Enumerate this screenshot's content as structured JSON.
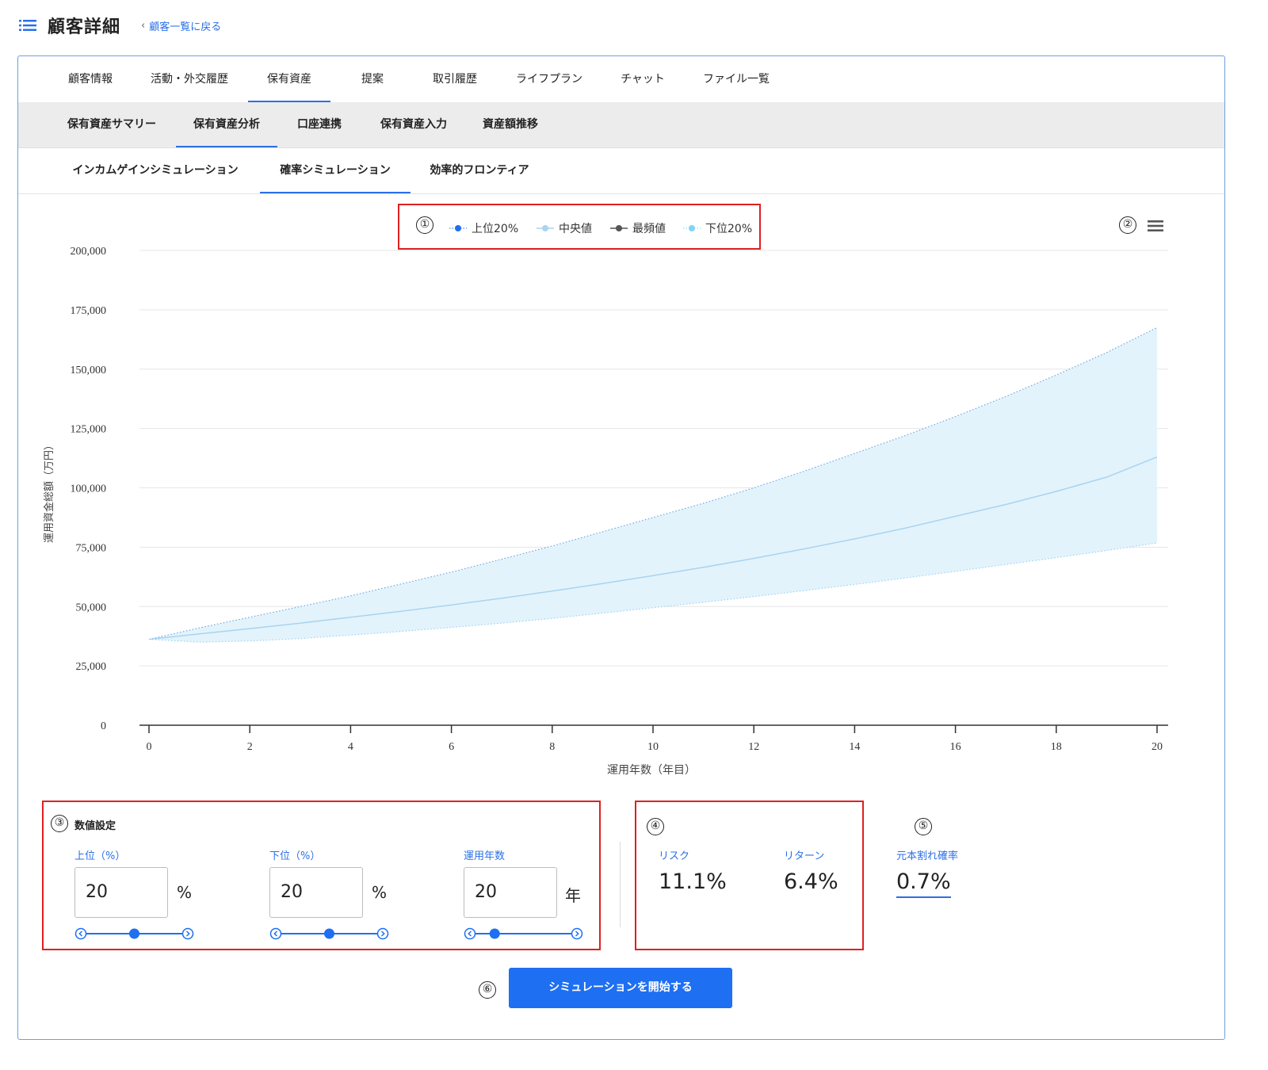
{
  "header": {
    "title": "顧客詳細",
    "back_link": "顧客一覧に戻る"
  },
  "tabs_primary": [
    "顧客情報",
    "活動・外交履歴",
    "保有資産",
    "提案",
    "取引履歴",
    "ライフプラン",
    "チャット",
    "ファイル一覧"
  ],
  "tabs_primary_active": "保有資産",
  "tabs_secondary": [
    "保有資産サマリー",
    "保有資産分析",
    "口座連携",
    "保有資産入力",
    "資産額推移"
  ],
  "tabs_secondary_active": "保有資産分析",
  "tabs_tertiary": [
    "インカムゲインシミュレーション",
    "確率シミュレーション",
    "効率的フロンティア"
  ],
  "tabs_tertiary_active": "確率シミュレーション",
  "annotations": [
    "①",
    "②",
    "③",
    "④",
    "⑤",
    "⑥"
  ],
  "chart_data": {
    "type": "area",
    "xlabel": "運用年数（年目）",
    "ylabel": "運用資金総額（万円）",
    "xlim": [
      0,
      20
    ],
    "ylim": [
      0,
      200000
    ],
    "x_ticks": [
      "0",
      "2",
      "4",
      "6",
      "8",
      "10",
      "12",
      "14",
      "16",
      "18",
      "20"
    ],
    "y_ticks": [
      "0",
      "25,000",
      "50,000",
      "75,000",
      "100,000",
      "125,000",
      "150,000",
      "175,000",
      "200,000"
    ],
    "legend_position": "top-center",
    "grid": true,
    "colors": {
      "upper": "#1e6ff2",
      "median": "#a8d4f0",
      "mode": "#555555",
      "lower": "#7dd6f5",
      "band": "#e3f3fc"
    },
    "x": [
      0,
      1,
      2,
      3,
      4,
      5,
      6,
      7,
      8,
      9,
      10,
      11,
      12,
      13,
      14,
      15,
      16,
      17,
      18,
      19,
      20
    ],
    "series": [
      {
        "name": "上位20%",
        "values": [
          36200,
          41000,
          45500,
          50000,
          54500,
          59500,
          64500,
          70000,
          75500,
          81500,
          87500,
          93500,
          100000,
          107000,
          114500,
          122000,
          130000,
          138500,
          147500,
          157000,
          167500
        ]
      },
      {
        "name": "中央値",
        "values": [
          36200,
          38500,
          40700,
          43000,
          45500,
          48000,
          50700,
          53500,
          56500,
          59700,
          63000,
          66500,
          70300,
          74300,
          78500,
          83000,
          88000,
          93000,
          98500,
          104500,
          113000
        ]
      },
      {
        "name": "最頻値",
        "values": []
      },
      {
        "name": "下位20%",
        "values": [
          36200,
          35000,
          35500,
          36500,
          38000,
          39500,
          41200,
          43000,
          45000,
          47200,
          49500,
          51800,
          54200,
          56700,
          59300,
          62000,
          64800,
          67700,
          70600,
          73600,
          76800
        ]
      }
    ]
  },
  "settings": {
    "title": "数値設定",
    "upper": {
      "label": "上位（%）",
      "value": "20",
      "unit": "%",
      "slider_position": 0.5
    },
    "lower": {
      "label": "下位（%）",
      "value": "20",
      "unit": "%",
      "slider_position": 0.5
    },
    "years": {
      "label": "運用年数",
      "value": "20",
      "unit": "年",
      "slider_position": 0.2
    }
  },
  "stats": {
    "risk": {
      "label": "リスク",
      "value": "11.1%"
    },
    "return": {
      "label": "リターン",
      "value": "6.4%"
    },
    "loss_prob": {
      "label": "元本割れ確率",
      "value": "0.7%"
    }
  },
  "start_button": "シミュレーションを開始する"
}
